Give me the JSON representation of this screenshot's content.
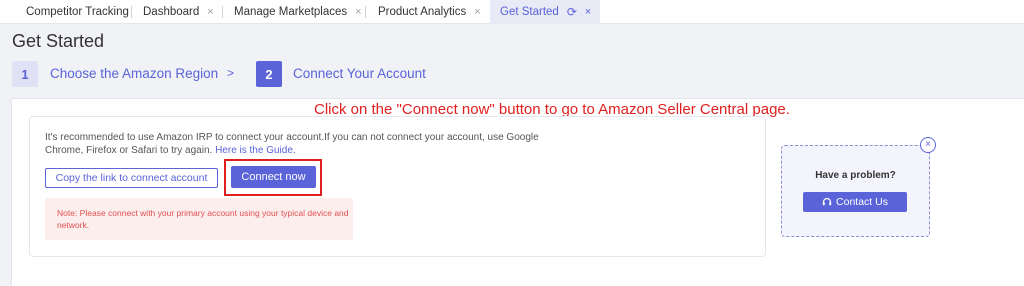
{
  "tabs": [
    {
      "label": "Competitor Tracking",
      "closable": false,
      "active": false
    },
    {
      "label": "Dashboard",
      "closable": true,
      "active": false
    },
    {
      "label": "Manage Marketplaces",
      "closable": true,
      "active": false
    },
    {
      "label": "Product Analytics",
      "closable": true,
      "active": false
    },
    {
      "label": "Get Started",
      "closable": true,
      "active": true
    }
  ],
  "icons": {
    "close": "×",
    "refresh": "⟳",
    "chevron": ">",
    "contact": "headset-icon"
  },
  "page_title": "Get Started",
  "steps": [
    {
      "number": "1",
      "label": "Choose the Amazon Region",
      "state": "completed"
    },
    {
      "number": "2",
      "label": "Connect Your Account",
      "state": "current"
    }
  ],
  "annotation": "Click on the \"Connect now\" button to go to Amazon Seller Central page.",
  "card": {
    "description": "It's recommended to use Amazon IRP to connect your account.If you can not connect your account, use Google Chrome, Firefox or Safari to try again.",
    "guide_link": "Here is the Guide.",
    "copy_button": "Copy the link to connect account",
    "connect_button": "Connect now",
    "note": "Note: Please connect with your primary account using your typical device and network."
  },
  "problem": {
    "title": "Have a problem?",
    "contact_button": "Contact Us"
  },
  "colors": {
    "accent": "#5a63d8",
    "annotation": "#e02020",
    "note_bg": "#fdeeee",
    "note_text": "#e05050"
  }
}
